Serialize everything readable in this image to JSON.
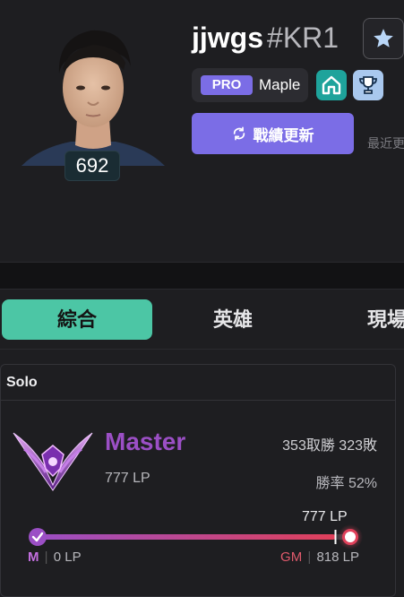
{
  "profile": {
    "name": "jjwgs",
    "tag": "#KR1",
    "level": "692",
    "pro_label": "PRO",
    "team": "Maple",
    "update_label": "戰績更新",
    "recent_label": "最近更"
  },
  "tabs": {
    "overview": "綜合",
    "champions": "英雄",
    "live": "現場"
  },
  "rank": {
    "queue": "Solo",
    "tier": "Master",
    "lp": "777 LP",
    "record": "353取勝 323敗",
    "win_rate": "勝率 52%",
    "current_lp_label": "777 LP",
    "progress_fraction": 0.95,
    "left_tier": "M",
    "left_lp": "0 LP",
    "right_tier": "GM",
    "right_lp": "818 LP"
  },
  "colors": {
    "accent_purple": "#7b6de6",
    "tab_active": "#4cc6a5",
    "master_purple": "#9b4fc5",
    "gm_red": "#e05a6c"
  },
  "icons": {
    "star": "star-icon",
    "team": "house-icon",
    "trophy": "trophy-icon",
    "refresh": "refresh-icon"
  }
}
